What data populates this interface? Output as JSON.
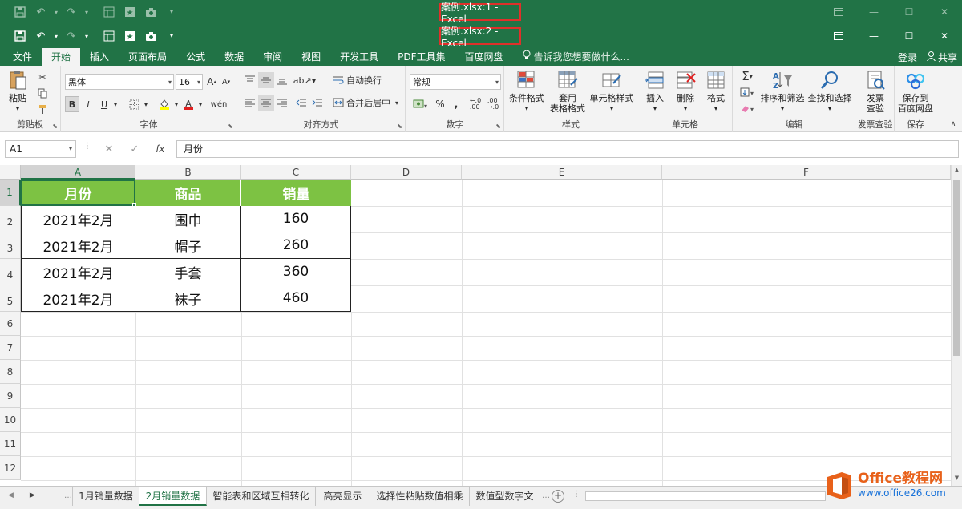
{
  "windows": [
    {
      "title": "案例.xlsx:1 - Excel"
    },
    {
      "title": "案例.xlsx:2 - Excel"
    }
  ],
  "ribbon_tabs": [
    "文件",
    "开始",
    "插入",
    "页面布局",
    "公式",
    "数据",
    "审阅",
    "视图",
    "开发工具",
    "PDF工具集",
    "百度网盘"
  ],
  "active_tab": "开始",
  "tell_me": "告诉我您想要做什么...",
  "account": {
    "login": "登录",
    "share": "共享"
  },
  "ribbon": {
    "clipboard": {
      "paste": "粘贴",
      "label": "剪贴板"
    },
    "font": {
      "name": "黑体",
      "size": "16",
      "label": "字体",
      "bold": "B",
      "italic": "I",
      "underline": "U"
    },
    "alignment": {
      "wrap": "自动换行",
      "merge": "合并后居中",
      "label": "对齐方式"
    },
    "number": {
      "format": "常规",
      "percent": "%",
      "comma": ",",
      "label": "数字"
    },
    "styles": {
      "conditional": "条件格式",
      "table_line1": "套用",
      "table_line2": "表格格式",
      "cell_styles": "单元格样式",
      "label": "样式"
    },
    "cells": {
      "insert": "插入",
      "delete": "删除",
      "format": "格式",
      "label": "单元格"
    },
    "editing": {
      "sort": "排序和筛选",
      "find": "查找和选择",
      "label": "编辑"
    },
    "invoice": {
      "line1": "发票",
      "line2": "查验",
      "label": "发票查验"
    },
    "save": {
      "line1": "保存到",
      "line2": "百度网盘",
      "label": "保存"
    }
  },
  "formula_bar": {
    "name_box": "A1",
    "fx": "fx",
    "content": "月份"
  },
  "columns": [
    "A",
    "B",
    "C",
    "D",
    "E",
    "F"
  ],
  "rows": [
    "1",
    "2",
    "3",
    "4",
    "5",
    "6",
    "7",
    "8",
    "9",
    "10",
    "11",
    "12"
  ],
  "table": {
    "headers": [
      "月份",
      "商品",
      "销量"
    ],
    "rows": [
      [
        "2021年2月",
        "围巾",
        "160"
      ],
      [
        "2021年2月",
        "帽子",
        "260"
      ],
      [
        "2021年2月",
        "手套",
        "360"
      ],
      [
        "2021年2月",
        "袜子",
        "460"
      ]
    ]
  },
  "sheets": [
    "1月销量数据",
    "2月销量数据",
    "智能表和区域互相转化",
    "高亮显示",
    "选择性粘贴数值相乘",
    "数值型数字文"
  ],
  "active_sheet": "2月销量数据",
  "watermark": {
    "brand": "Office教程网",
    "url": "www.office26.com"
  },
  "colors": {
    "excel_green": "#217346",
    "header_fill": "#7dc243",
    "highlight_border": "#e0302a"
  }
}
